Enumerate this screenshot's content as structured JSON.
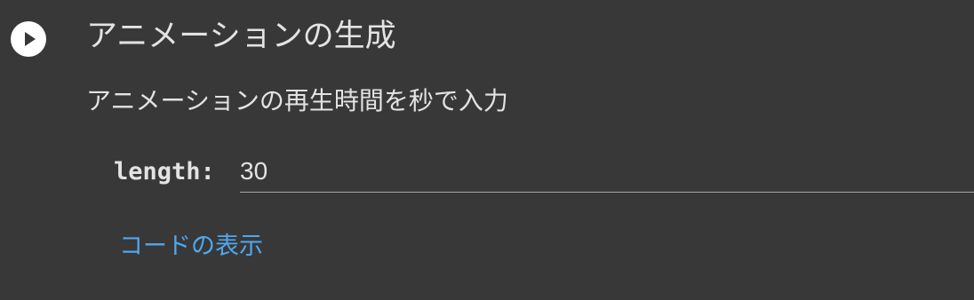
{
  "cell": {
    "title": "アニメーションの生成",
    "run_icon": "play-icon",
    "description": "アニメーションの再生時間を秒で入力",
    "param": {
      "label": "length:",
      "value": "30"
    },
    "show_code_label": "コードの表示"
  },
  "colors": {
    "background": "#383838",
    "text": "#e3e3e3",
    "link": "#4fa8ee",
    "run_button": "#ffffff"
  }
}
